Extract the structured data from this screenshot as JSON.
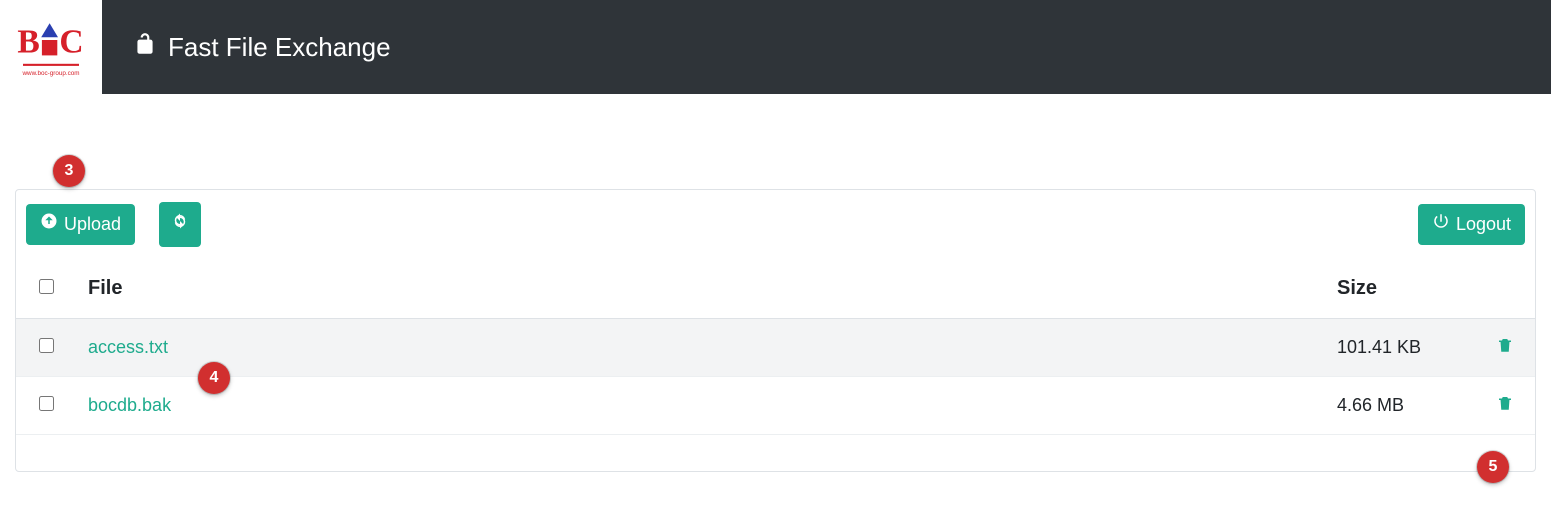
{
  "header": {
    "title": "Fast File Exchange"
  },
  "toolbar": {
    "upload_label": "Upload",
    "logout_label": "Logout"
  },
  "table": {
    "headers": {
      "file": "File",
      "size": "Size"
    },
    "rows": [
      {
        "name": "access.txt",
        "size": "101.41 KB"
      },
      {
        "name": "bocdb.bak",
        "size": "4.66 MB"
      }
    ]
  },
  "annotations": {
    "upload": "3",
    "first_file": "4",
    "delete": "5"
  }
}
